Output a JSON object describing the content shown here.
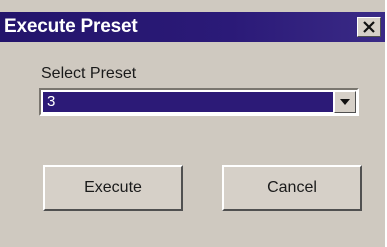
{
  "window": {
    "title": "Execute Preset",
    "close_icon": "close-icon"
  },
  "preset": {
    "label": "Select Preset",
    "selected_value": "3",
    "dropdown_icon": "chevron-down-icon"
  },
  "buttons": {
    "execute_label": "Execute",
    "cancel_label": "Cancel"
  },
  "colors": {
    "titlebar": "#23146b",
    "selection": "#2c1a77",
    "dialog_face": "#cfc9c0"
  }
}
